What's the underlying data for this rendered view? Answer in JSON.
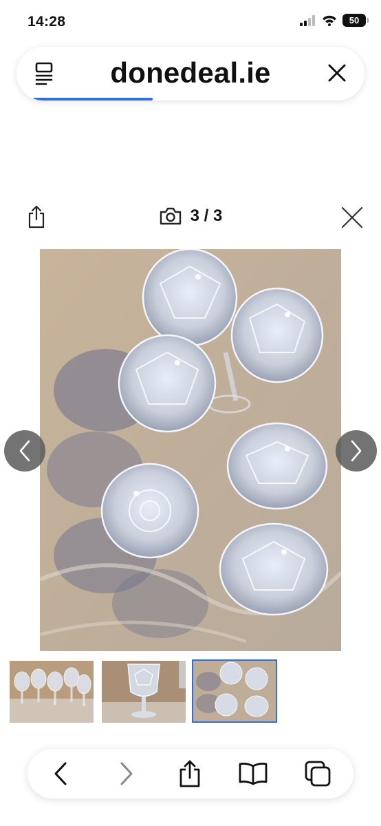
{
  "status_bar": {
    "time": "14:28",
    "battery": "50"
  },
  "address_bar": {
    "url": "donedeal.ie",
    "load_progress": 0.36
  },
  "gallery": {
    "counter": "3 / 3",
    "current_index": 3,
    "total": 3,
    "thumbnails": [
      {
        "label": "Photo 1 - crystal glasses on table"
      },
      {
        "label": "Photo 2 - single crystal glass"
      },
      {
        "label": "Photo 3 - crystal glasses top view",
        "selected": true
      }
    ]
  },
  "icons": {
    "reader": "reader-mode-icon",
    "close": "close-icon",
    "share": "share-icon",
    "camera": "camera-icon",
    "back": "chevron-left-icon",
    "forward": "chevron-right-icon",
    "bookmarks": "book-icon",
    "tabs": "tabs-icon"
  },
  "colors": {
    "accent": "#2f6fdd",
    "nav_button": "#5a5a5a"
  }
}
